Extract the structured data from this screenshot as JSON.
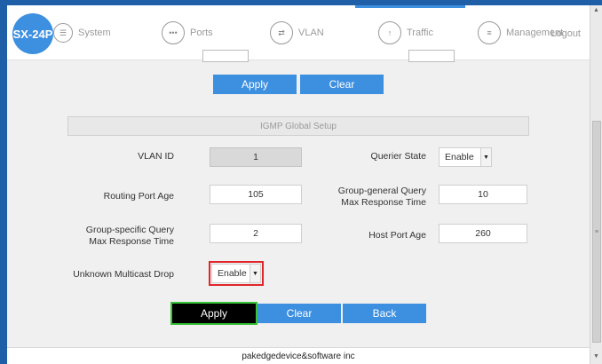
{
  "nav": {
    "logo": "SX-24P",
    "items": [
      {
        "label": "System",
        "icon": "sliders-icon"
      },
      {
        "label": "Ports",
        "icon": "ellipsis-icon"
      },
      {
        "label": "VLAN",
        "icon": "vlan-icon"
      },
      {
        "label": "Traffic",
        "icon": "arrow-up-icon"
      },
      {
        "label": "Management",
        "icon": "menu-icon"
      }
    ],
    "logout": "Logout"
  },
  "top_form": {
    "apply": "Apply",
    "clear": "Clear"
  },
  "igmp": {
    "title": "IGMP Global Setup",
    "vlan_id_label": "VLAN ID",
    "vlan_id_value": "1",
    "querier_state_label": "Querier State",
    "querier_state_value": "Enable",
    "routing_port_age_label": "Routing Port Age",
    "routing_port_age_value": "105",
    "group_general_label": "Group-general Query Max Response Time",
    "group_general_value": "10",
    "group_specific_label": "Group-specific Query Max Response Time",
    "group_specific_value": "2",
    "host_port_age_label": "Host Port Age",
    "host_port_age_value": "260",
    "unknown_multicast_label": "Unknown Multicast Drop",
    "unknown_multicast_value": "Enable"
  },
  "actions": {
    "apply": "Apply",
    "clear": "Clear",
    "back": "Back"
  },
  "footer": "pakedgedevice&software inc",
  "colors": {
    "accent": "#3d8fe0",
    "highlight_red": "#e0262a",
    "highlight_green": "#3ac23a"
  }
}
